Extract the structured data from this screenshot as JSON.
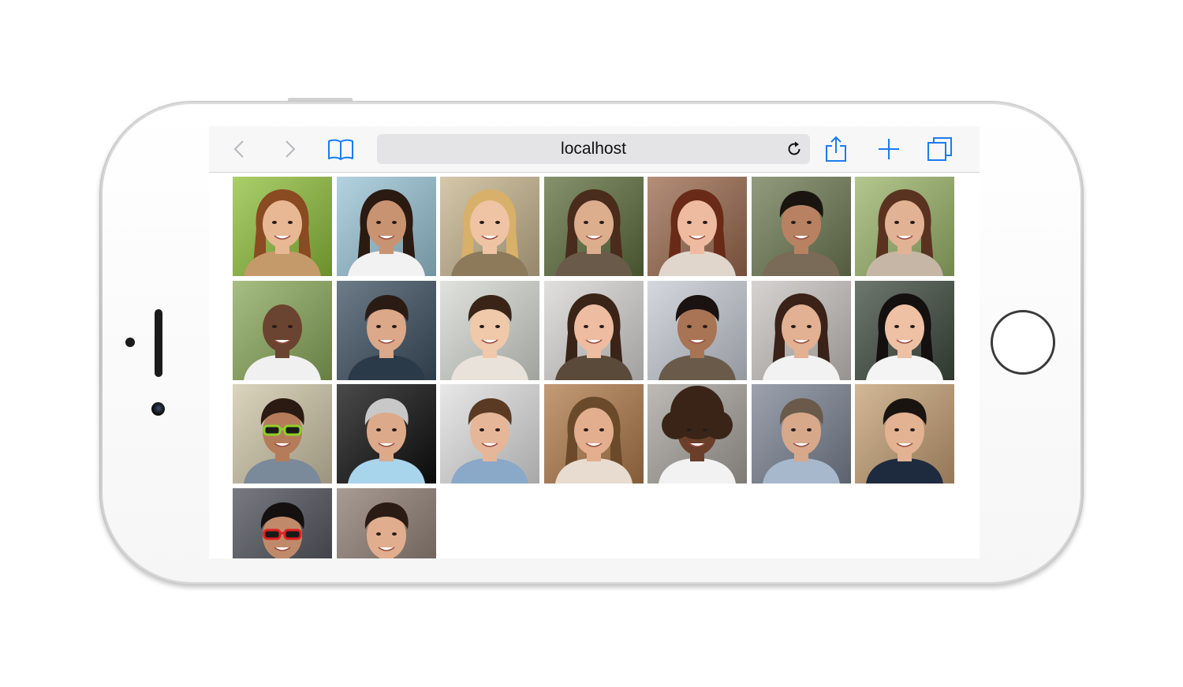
{
  "browser": {
    "url": "localhost",
    "icons": {
      "back": "chevron-left-icon",
      "forward": "chevron-right-icon",
      "bookmarks": "book-icon",
      "reload": "reload-icon",
      "share": "share-icon",
      "new_tab": "plus-icon",
      "tabs": "tabs-icon"
    },
    "accent_color": "#1a7bf2",
    "disabled_color": "#b8b8bc"
  },
  "photos": [
    {
      "bg": "#8fbf3a",
      "skin": "#e8b894",
      "hair": "#8a4a22",
      "shirt": "#c49a6a",
      "style": "long"
    },
    {
      "bg": "#9ac4d6",
      "skin": "#c89370",
      "hair": "#2a1a12",
      "shirt": "#f2f2f2",
      "style": "long"
    },
    {
      "bg": "#c7b58e",
      "skin": "#efc4a4",
      "hair": "#d8b06a",
      "shirt": "#8c7a5a",
      "style": "long"
    },
    {
      "bg": "#5d6e3c",
      "skin": "#dcae8e",
      "hair": "#4a2c1c",
      "shirt": "#6a5a4a",
      "style": "long"
    },
    {
      "bg": "#9a6a4e",
      "skin": "#eebba0",
      "hair": "#6a2a18",
      "shirt": "#e0d6cc",
      "style": "long"
    },
    {
      "bg": "#6e7a52",
      "skin": "#b88262",
      "hair": "#1a1410",
      "shirt": "#7a6a58",
      "style": "short"
    },
    {
      "bg": "#9ab46a",
      "skin": "#e2b294",
      "hair": "#5a3220",
      "shirt": "#c6b6a6",
      "style": "long"
    },
    {
      "bg": "#8aa85a",
      "skin": "#6a4430",
      "hair": "#2a1a12",
      "shirt": "#f0f0f0",
      "style": "bald"
    },
    {
      "bg": "#3c5060",
      "skin": "#dba88a",
      "hair": "#2a1c14",
      "shirt": "#2a3a48",
      "style": "short"
    },
    {
      "bg": "#d6dad2",
      "skin": "#f0c8aa",
      "hair": "#3a2418",
      "shirt": "#e8e2da",
      "style": "short"
    },
    {
      "bg": "#d8d6d4",
      "skin": "#eebca0",
      "hair": "#3a2418",
      "shirt": "#5a4a3a",
      "style": "long"
    },
    {
      "bg": "#c6ccd4",
      "skin": "#a87454",
      "hair": "#1a1210",
      "shirt": "#6a5a4a",
      "style": "short"
    },
    {
      "bg": "#c8c4c0",
      "skin": "#e2b092",
      "hair": "#3a2218",
      "shirt": "#f2f2f2",
      "style": "long"
    },
    {
      "bg": "#3e4a3e",
      "skin": "#eec0a4",
      "hair": "#141010",
      "shirt": "#f4f4f4",
      "style": "long"
    },
    {
      "bg": "#d0c6a8",
      "skin": "#b47c5a",
      "hair": "#2a1a12",
      "shirt": "#7a8a9a",
      "style": "glasses-green"
    },
    {
      "bg": "#0e0e0e",
      "skin": "#dcaa8a",
      "hair": "#c8c8c8",
      "shirt": "#a8d4ec",
      "style": "short"
    },
    {
      "bg": "#e0e0e0",
      "skin": "#e6b698",
      "hair": "#5a3a22",
      "shirt": "#8aa8c8",
      "style": "short"
    },
    {
      "bg": "#b07a4a",
      "skin": "#e2ae8e",
      "hair": "#6a4a2a",
      "shirt": "#e8dcd0",
      "style": "long"
    },
    {
      "bg": "#a8a49e",
      "skin": "#6a3e28",
      "hair": "#3a2418",
      "shirt": "#f2f2f2",
      "style": "curly"
    },
    {
      "bg": "#7a8494",
      "skin": "#d8a88a",
      "hair": "#6a5a4a",
      "shirt": "#a8b8cc",
      "style": "short"
    },
    {
      "bg": "#c4a074",
      "skin": "#e2b292",
      "hair": "#1a1410",
      "shirt": "#1e2a3e",
      "style": "short"
    },
    {
      "bg": "#4a4e56",
      "skin": "#c08a6a",
      "hair": "#141010",
      "shirt": "#3a3a3a",
      "style": "glasses-red"
    },
    {
      "bg": "#8a7a70",
      "skin": "#e0ae8e",
      "hair": "#2a1c14",
      "shirt": "#5a5a5a",
      "style": "short"
    }
  ]
}
